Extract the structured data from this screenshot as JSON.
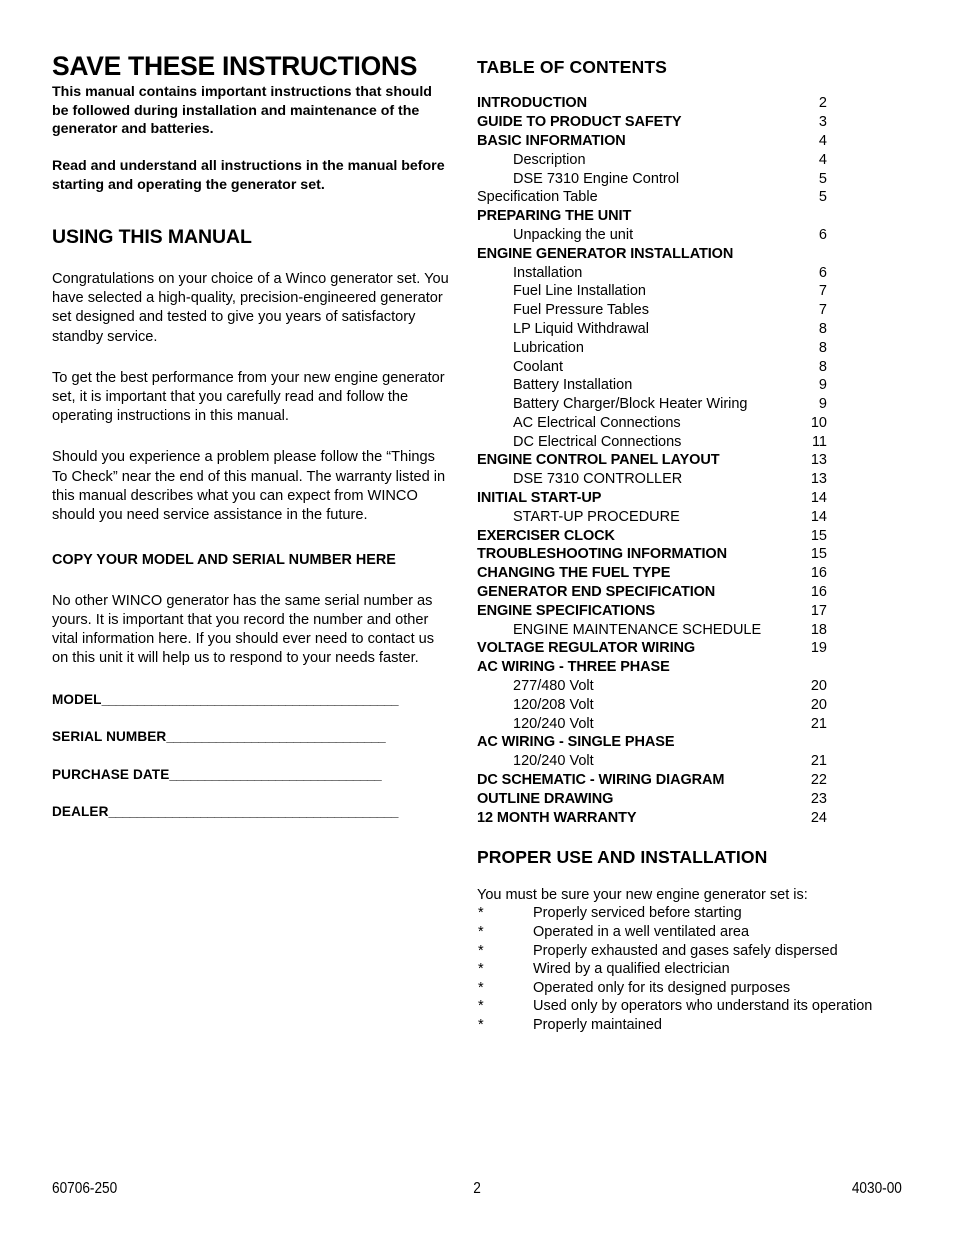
{
  "left_column": {
    "doc_title": "SAVE THESE INSTRUCTIONS",
    "lead_paragraph_1": "This manual contains important instructions that should be followed during installation and maintenance of the generator and batteries.",
    "lead_paragraph_2": "Read and understand all instructions in the manual before starting and operating the generator set.",
    "section_heading": "USING THIS MANUAL",
    "paragraph_1": "Congratulations on your choice of a Winco generator set. You have selected a high-quality, precision-engineered generator set designed and tested to give you years of satisfactory standby service.",
    "paragraph_2": "To get the best performance from your new engine generator set, it is important that you carefully read and follow the operating instructions in this manual.",
    "paragraph_3": "Should you experience a problem please follow the “Things To Check” near the end of this manual. The warranty listed in this manual describes what you can expect from WINCO should you need service assistance in the future.",
    "copy_heading": "COPY YOUR MODEL AND SERIAL NUMBER HERE",
    "paragraph_4": "No other WINCO generator has the same serial number as yours.  It is important that you record the number and other vital information here. If you should ever need to contact us on this unit it will help us to respond to your needs faster.",
    "form_fields": [
      {
        "label": "MODEL",
        "rule": "__________________________________________"
      },
      {
        "label": "SERIAL NUMBER",
        "rule": "_______________________________"
      },
      {
        "label": "PURCHASE DATE",
        "rule": "______________________________"
      },
      {
        "label": "DEALER",
        "rule": "_________________________________________"
      }
    ]
  },
  "right_column": {
    "toc_title": "TABLE OF CONTENTS",
    "toc_entries": [
      {
        "label": "INTRODUCTION",
        "page": "2",
        "level": "lvl0"
      },
      {
        "label": "GUIDE TO PRODUCT SAFETY",
        "page": "3",
        "level": "lvl0"
      },
      {
        "label": "BASIC INFORMATION",
        "page": "4",
        "level": "lvl0"
      },
      {
        "label": "Description",
        "page": "4",
        "level": "lvl1"
      },
      {
        "label": "DSE 7310  Engine Control",
        "page": "5",
        "level": "lvl1"
      },
      {
        "label": "Specification Table",
        "page": "5",
        "level": "lvl0p"
      },
      {
        "label": "PREPARING THE UNIT",
        "page": "",
        "level": "lvl0"
      },
      {
        "label": "Unpacking the unit",
        "page": "6",
        "level": "lvl1"
      },
      {
        "label": "ENGINE GENERATOR INSTALLATION",
        "page": "",
        "level": "lvl0"
      },
      {
        "label": "Installation",
        "page": "6",
        "level": "lvl1"
      },
      {
        "label": "Fuel Line Installation",
        "page": "7",
        "level": "lvl1"
      },
      {
        "label": "Fuel Pressure Tables",
        "page": "7",
        "level": "lvl1"
      },
      {
        "label": "LP Liquid Withdrawal",
        "page": "8",
        "level": "lvl1"
      },
      {
        "label": "Lubrication",
        "page": "8",
        "level": "lvl1"
      },
      {
        "label": "Coolant",
        "page": "8",
        "level": "lvl1"
      },
      {
        "label": "Battery Installation",
        "page": "9",
        "level": "lvl1"
      },
      {
        "label": "Battery Charger/Block Heater Wiring",
        "page": "9",
        "level": "lvl1"
      },
      {
        "label": "AC Electrical Connections",
        "page": "10",
        "level": "lvl1"
      },
      {
        "label": "DC Electrical Connections",
        "page": "11",
        "level": "lvl1"
      },
      {
        "label": "ENGINE CONTROL PANEL LAYOUT",
        "page": "13",
        "level": "lvl0"
      },
      {
        "label": "DSE 7310 CONTROLLER",
        "page": "13",
        "level": "lvl1"
      },
      {
        "label": "INITIAL START-UP",
        "page": "14",
        "level": "lvl0"
      },
      {
        "label": "START-UP PROCEDURE",
        "page": "14",
        "level": "lvl1"
      },
      {
        "label": "EXERCISER CLOCK",
        "page": "15",
        "level": "lvl0"
      },
      {
        "label": "TROUBLESHOOTING INFORMATION",
        "page": "15",
        "level": "lvl0"
      },
      {
        "label": "CHANGING THE FUEL TYPE",
        "page": "16",
        "level": "lvl0"
      },
      {
        "label": "GENERATOR END SPECIFICATION",
        "page": "16",
        "level": "lvl0"
      },
      {
        "label": "ENGINE SPECIFICATIONS",
        "page": "17",
        "level": "lvl0"
      },
      {
        "label": "ENGINE MAINTENANCE SCHEDULE",
        "page": "18",
        "level": "lvl1"
      },
      {
        "label": "VOLTAGE REGULATOR WIRING",
        "page": "19",
        "level": "lvl0"
      },
      {
        "label": "AC WIRING - THREE PHASE",
        "page": "",
        "level": "lvl0"
      },
      {
        "label": "277/480 Volt",
        "page": "20",
        "level": "lvl1"
      },
      {
        "label": "120/208 Volt",
        "page": "20",
        "level": "lvl1"
      },
      {
        "label": "120/240 Volt",
        "page": "21",
        "level": "lvl1"
      },
      {
        "label": "AC WIRING - SINGLE PHASE",
        "page": "",
        "level": "lvl0"
      },
      {
        "label": "120/240 Volt",
        "page": "21",
        "level": "lvl1"
      },
      {
        "label": "DC SCHEMATIC - WIRING DIAGRAM",
        "page": "22",
        "level": "lvl0"
      },
      {
        "label": "OUTLINE DRAWING",
        "page": "23",
        "level": "lvl0"
      },
      {
        "label": "12 MONTH WARRANTY",
        "page": "24",
        "level": "lvl0"
      }
    ],
    "proper_use_heading": "PROPER USE AND INSTALLATION",
    "proper_use_intro": "You must be sure your new engine generator set is:",
    "bullet_marker": "*",
    "proper_use_items": [
      "Properly serviced before starting",
      "Operated in a well ventilated area",
      "Properly exhausted and gases safely dispersed",
      "Wired by a qualified electrician",
      "Operated only for its designed purposes",
      "Used only by operators who understand its operation",
      "Properly maintained"
    ]
  },
  "footer": {
    "left": "60706-250",
    "center": "2",
    "right": "4030-00"
  }
}
